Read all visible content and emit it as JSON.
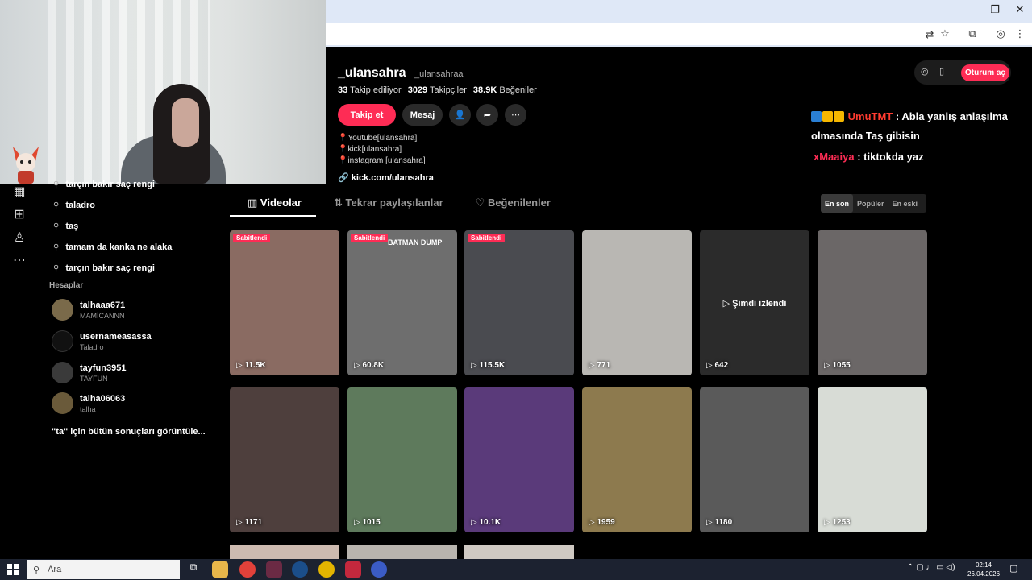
{
  "browser": {
    "toolbar_icons": [
      "translate-icon",
      "star-icon",
      "extensions-icon",
      "profile-icon",
      "menu-icon"
    ],
    "window_controls": [
      "minimize-icon",
      "restore-icon",
      "close-icon"
    ]
  },
  "sidebar": {
    "suggestions": [
      {
        "text": "tarçın bakır saç rengi"
      },
      {
        "text": "taladro"
      },
      {
        "text": "taş"
      },
      {
        "text": "tamam da kanka ne alaka"
      },
      {
        "text": "tarçın bakır saç rengi"
      }
    ],
    "accounts_header": "Hesaplar",
    "accounts": [
      {
        "name": "talhaaa671",
        "sub": "MAMİCANNN"
      },
      {
        "name": "usernameasassa",
        "sub": "Taladro"
      },
      {
        "name": "tayfun3951",
        "sub": "TAYFUN"
      },
      {
        "name": "talha06063",
        "sub": "talha"
      }
    ],
    "all_results": "\"ta\" için bütün sonuçları görüntüle..."
  },
  "profile": {
    "username": "_ulansahra",
    "nickname": "_ulansahraa",
    "following_count": "33",
    "following_label": "Takip ediliyor",
    "followers_count": "3029",
    "followers_label": "Takipçiler",
    "likes_count": "38.9K",
    "likes_label": "Beğeniler",
    "follow_label": "Takip et",
    "message_label": "Mesaj",
    "bio": [
      "📍Youtube[ulansahra]",
      "📍kick[ulansahra]",
      "📍instagram [ulansahra]"
    ],
    "link": "kick.com/ulansahra"
  },
  "login_label": "Oturum aç",
  "chat": [
    {
      "user": "UmuTMT",
      "message": ": Abla yanlış anlaşılma",
      "cont": "olmasında Taş gibisin"
    },
    {
      "user": "xMaaiya",
      "message": ": tiktokda yaz"
    }
  ],
  "tabs": [
    "Videolar",
    "Tekrar paylaşılanlar",
    "Beğenilenler"
  ],
  "sort": [
    "En son",
    "Popüler",
    "En eski"
  ],
  "videos": [
    {
      "views": "11.5K",
      "pinned": "Sabitlendi",
      "bg": "#8a6b62"
    },
    {
      "views": "60.8K",
      "pinned": "Sabitlendi",
      "bg": "#6e6e6e",
      "caption": "BATMAN DUMP"
    },
    {
      "views": "115.5K",
      "pinned": "Sabitlendi",
      "bg": "#4a4b50"
    },
    {
      "views": "771",
      "bg": "#b9b7b3"
    },
    {
      "views": "642",
      "bg": "#2b2b2b",
      "watched": "▷ Şimdi izlendi"
    },
    {
      "views": "1055",
      "bg": "#6b6767"
    },
    {
      "views": "1171",
      "bg": "#4e3f3d"
    },
    {
      "views": "1015",
      "bg": "#5e7a5c"
    },
    {
      "views": "10.1K",
      "bg": "#5a3a7a"
    },
    {
      "views": "1959",
      "bg": "#8d7a4e"
    },
    {
      "views": "1180",
      "bg": "#5a5a5a"
    },
    {
      "views": "1253",
      "bg": "#d8dcd6"
    }
  ],
  "taskbar": {
    "search_placeholder": "Ara",
    "time": "02:14",
    "date": "26.04.2026"
  }
}
